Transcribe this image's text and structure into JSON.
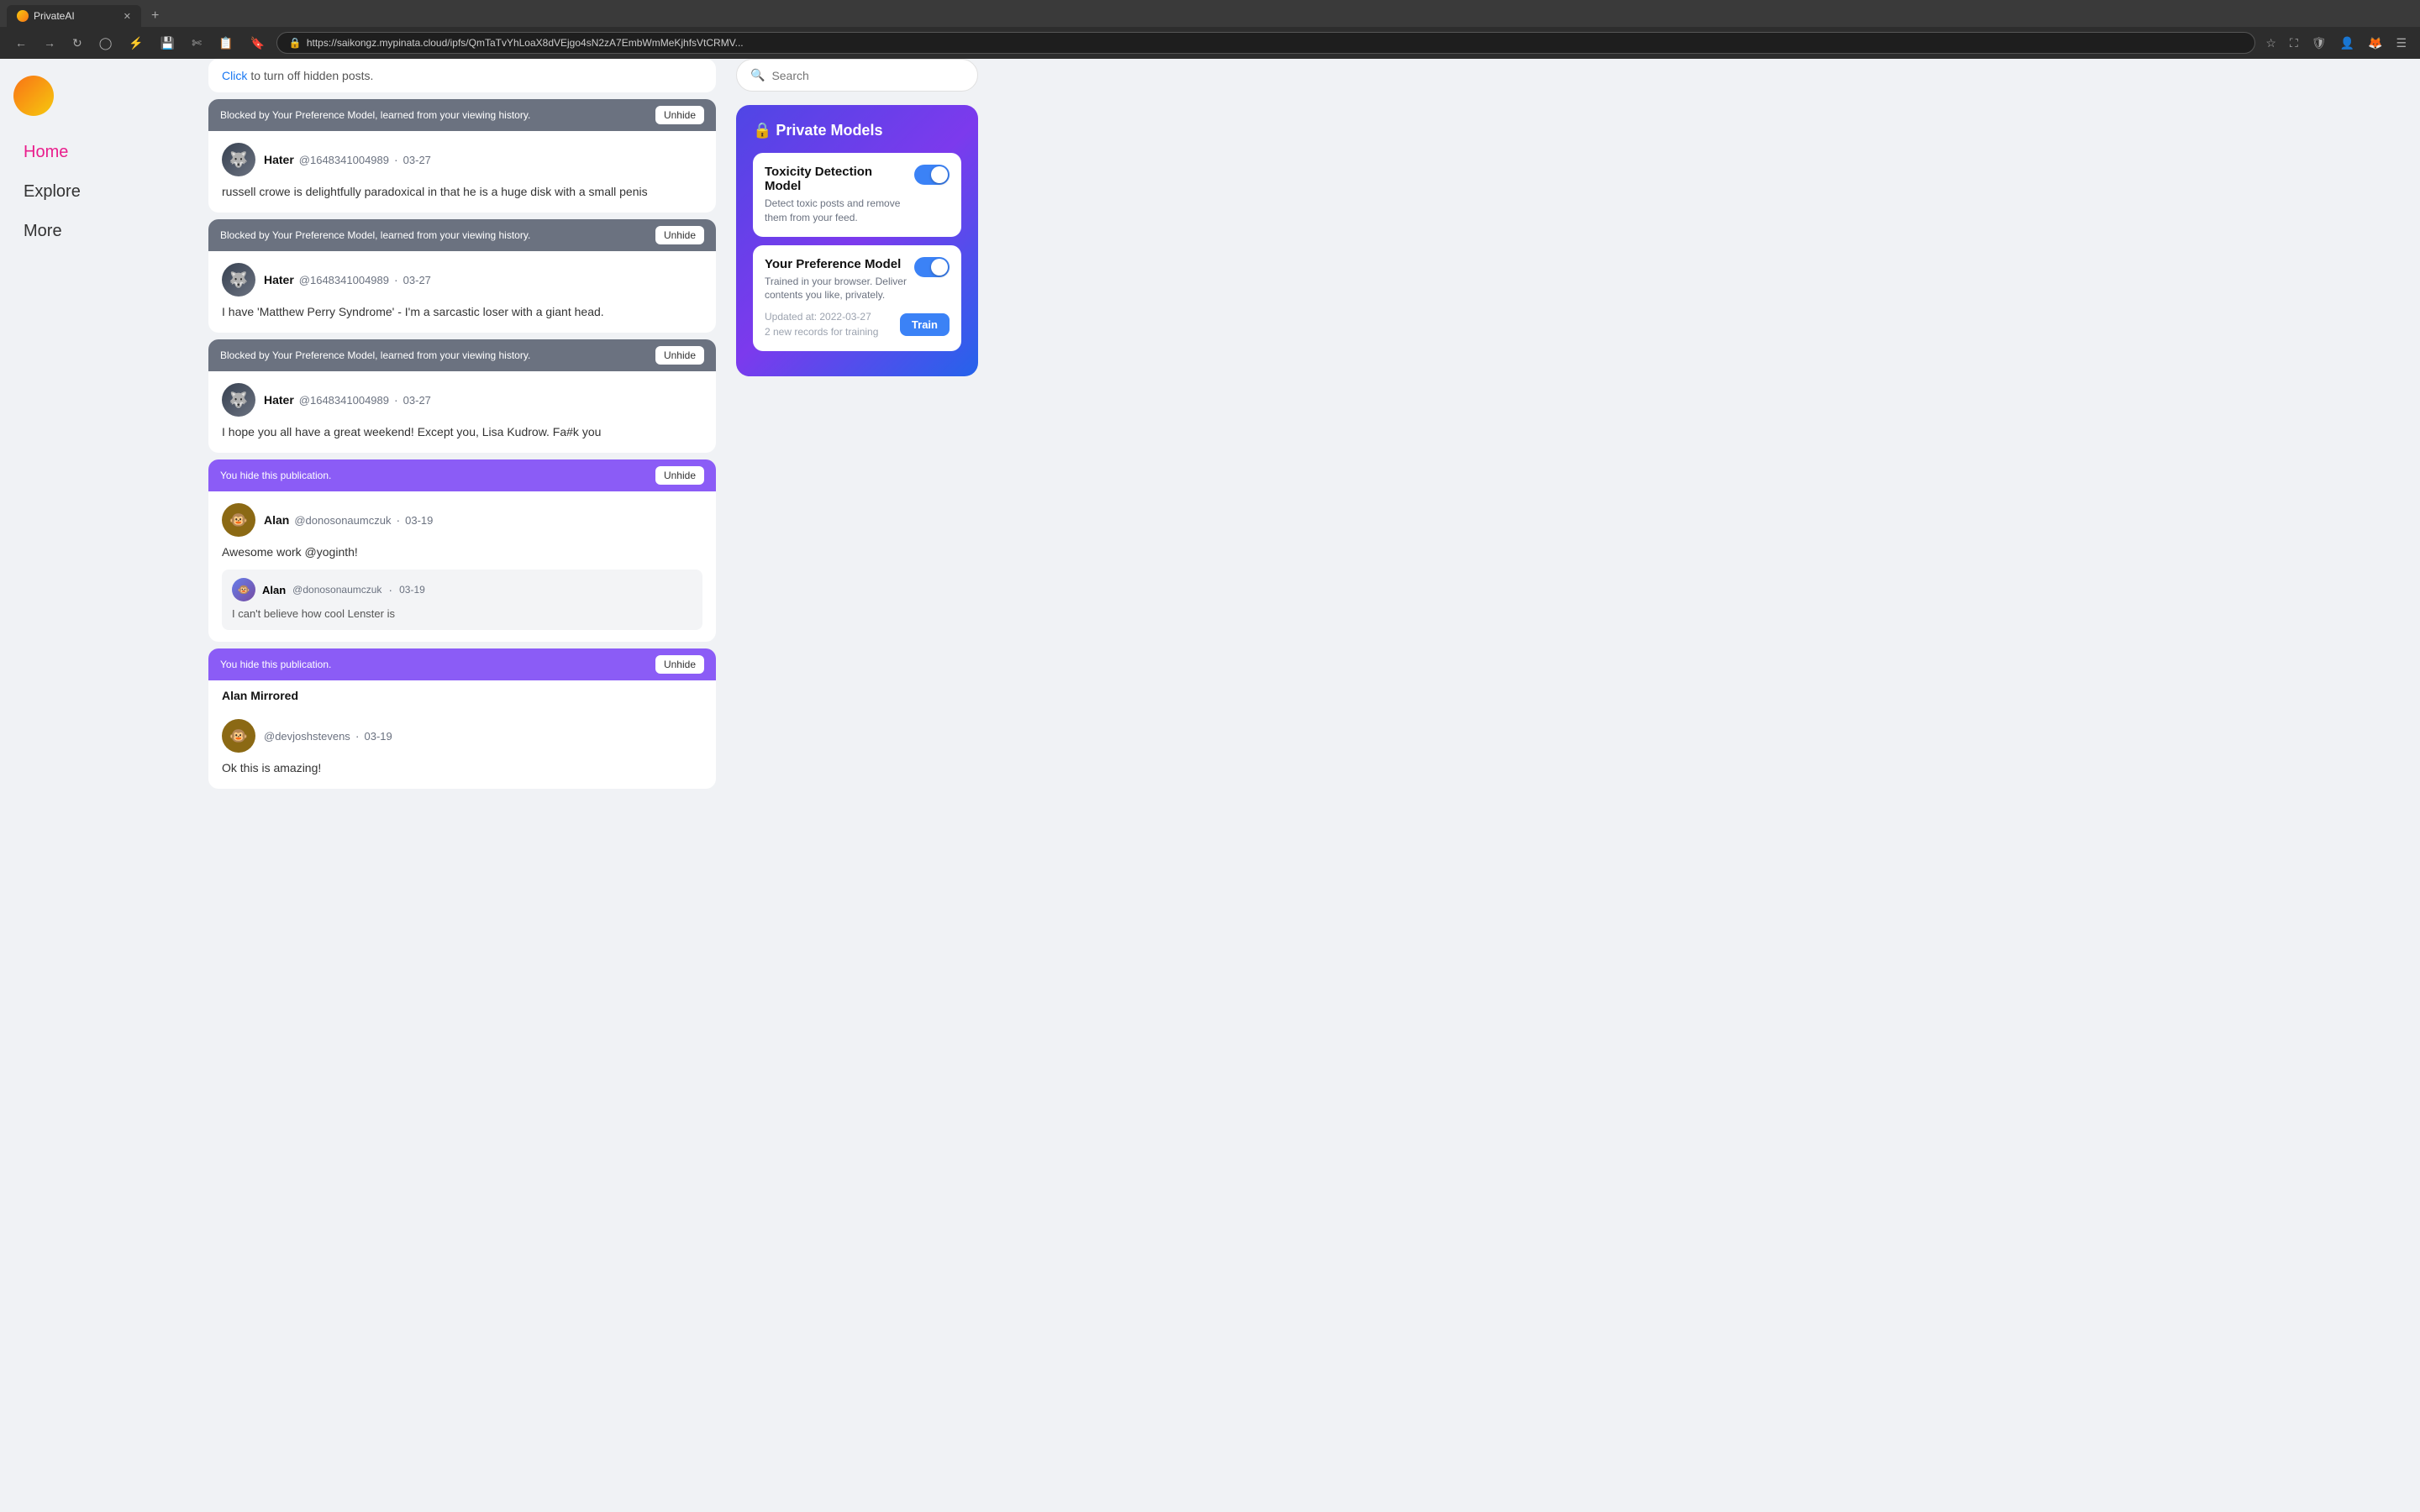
{
  "browser": {
    "tab_title": "PrivateAI",
    "tab_favicon": "🟡",
    "new_tab_label": "+",
    "address": "https://saikongz.mypinata.cloud/ipfs/QmTaTvYhLoaX8dVEjgo4sN2zA7EmbWmMeKjhfsVtCRMV...",
    "nav_back": "←",
    "nav_forward": "→",
    "nav_refresh": "↻",
    "nav_history": "⊙",
    "nav_extensions": "⚡",
    "nav_star": "☆"
  },
  "sidebar": {
    "nav_items": [
      {
        "label": "Home",
        "active": true
      },
      {
        "label": "Explore",
        "active": false
      },
      {
        "label": "More",
        "active": false
      }
    ]
  },
  "click_notice": {
    "link_text": "Click",
    "rest_text": " to turn off hidden posts."
  },
  "posts": [
    {
      "id": "post1",
      "blocked": true,
      "block_reason": "Blocked by Your Preference Model, learned from your viewing history.",
      "unhide_label": "Unhide",
      "author_name": "Hater",
      "author_handle": "@1648341004989",
      "date": "03-27",
      "text": "russell crowe is delightfully paradoxical in that he is a huge disk with a small penis"
    },
    {
      "id": "post2",
      "blocked": true,
      "block_reason": "Blocked by Your Preference Model, learned from your viewing history.",
      "unhide_label": "Unhide",
      "author_name": "Hater",
      "author_handle": "@1648341004989",
      "date": "03-27",
      "text": "I have 'Matthew Perry Syndrome' - I'm a sarcastic loser with a giant head."
    },
    {
      "id": "post3",
      "blocked": true,
      "block_reason": "Blocked by Your Preference Model, learned from your viewing history.",
      "unhide_label": "Unhide",
      "author_name": "Hater",
      "author_handle": "@1648341004989",
      "date": "03-27",
      "text": "I hope you all have a great weekend! Except you, Lisa Kudrow. Fa#k you"
    },
    {
      "id": "post4",
      "hidden": true,
      "hide_reason": "You hide this publication.",
      "unhide_label": "Unhide",
      "author_name": "Alan",
      "author_handle": "@donosonaumczuk",
      "date": "03-19",
      "text": "Awesome work @yoginth!",
      "quoted": {
        "author_name": "Alan",
        "author_handle": "@donosonaumczuk",
        "date": "03-19",
        "text": "I can't believe how cool Lenster is"
      }
    },
    {
      "id": "post5",
      "hidden": true,
      "hide_reason": "You hide this publication.",
      "unhide_label": "Unhide",
      "mirrored_label": "Alan Mirrored",
      "author_name": "@devjoshstevens",
      "date": "03-19",
      "text": "Ok this is amazing!"
    }
  ],
  "right_panel": {
    "search_placeholder": "Search",
    "private_models": {
      "title": "🔒 Private Models",
      "models": [
        {
          "name": "Toxicity Detection Model",
          "description": "Detect toxic posts and remove them from your feed.",
          "toggle_on": true
        },
        {
          "name": "Your Preference Model",
          "description": "Trained in your browser. Deliver contents you like, privately.",
          "toggle_on": true,
          "updated_at": "Updated at: 2022-03-27",
          "new_records": "2 new records for training",
          "train_label": "Train"
        }
      ]
    }
  }
}
